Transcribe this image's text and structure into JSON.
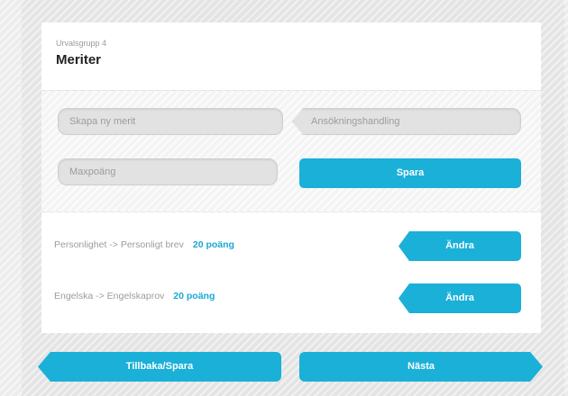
{
  "header": {
    "subtitle": "Urvalsgrupp 4",
    "title": "Meriter"
  },
  "form": {
    "merit_placeholder": "Skapa ny merit",
    "handling_placeholder": "Ansökningshandling",
    "max_placeholder": "Maxpoäng",
    "save_label": "Spara"
  },
  "merits": [
    {
      "label": "Personlighet -> Personligt brev",
      "points": "20 poäng",
      "action": "Ändra"
    },
    {
      "label": "Engelska -> Engelskaprov",
      "points": "20 poäng",
      "action": "Ändra"
    }
  ],
  "footer": {
    "back_label": "Tillbaka/Spara",
    "next_label": "Nästa"
  },
  "colors": {
    "accent": "#1ab0d8",
    "points": "#1aa8d4",
    "field": "#e2e2e2"
  }
}
